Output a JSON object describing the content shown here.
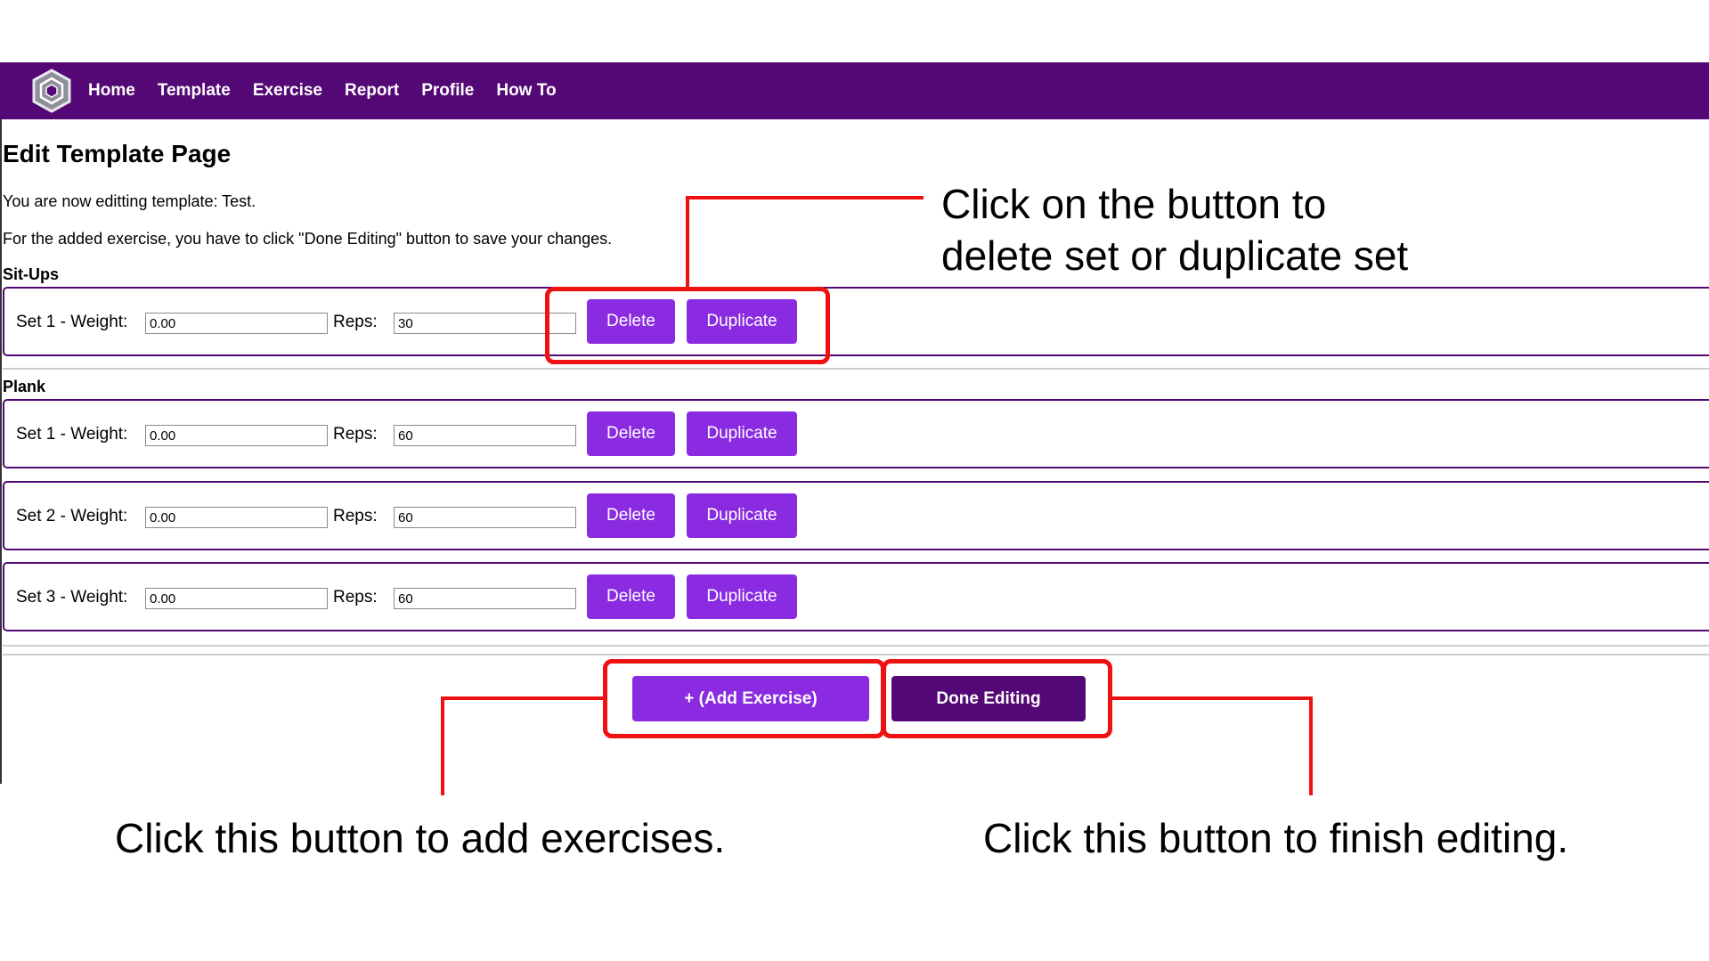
{
  "nav": {
    "items": [
      "Home",
      "Template",
      "Exercise",
      "Report",
      "Profile",
      "How To"
    ]
  },
  "page": {
    "title": "Edit Template Page",
    "info1": "You are now editting template: Test.",
    "info2": "For the added exercise, you have to click \"Done Editing\" button to save your changes."
  },
  "exercises": [
    {
      "name": "Sit-Ups",
      "sets": [
        {
          "label": "Set 1 - Weight:",
          "weight": "0.00",
          "reps": "30"
        }
      ]
    },
    {
      "name": "Plank",
      "sets": [
        {
          "label": "Set 1 - Weight:",
          "weight": "0.00",
          "reps": "60"
        },
        {
          "label": "Set 2 - Weight:",
          "weight": "0.00",
          "reps": "60"
        },
        {
          "label": "Set 3 - Weight:",
          "weight": "0.00",
          "reps": "60"
        }
      ]
    }
  ],
  "labels": {
    "reps": "Reps:",
    "delete": "Delete",
    "duplicate": "Duplicate"
  },
  "actions": {
    "add_exercise": "+ (Add Exercise)",
    "done_editing": "Done Editing"
  },
  "annotations": {
    "top_line1": "Click on the button to",
    "top_line2": "delete set or duplicate set",
    "bottom_left": "Click this button to add exercises.",
    "bottom_right": "Click this button to finish editing."
  },
  "colors": {
    "navbar": "#540875",
    "button": "#8a2be2",
    "done_button": "#540875",
    "highlight": "#ee1111"
  }
}
